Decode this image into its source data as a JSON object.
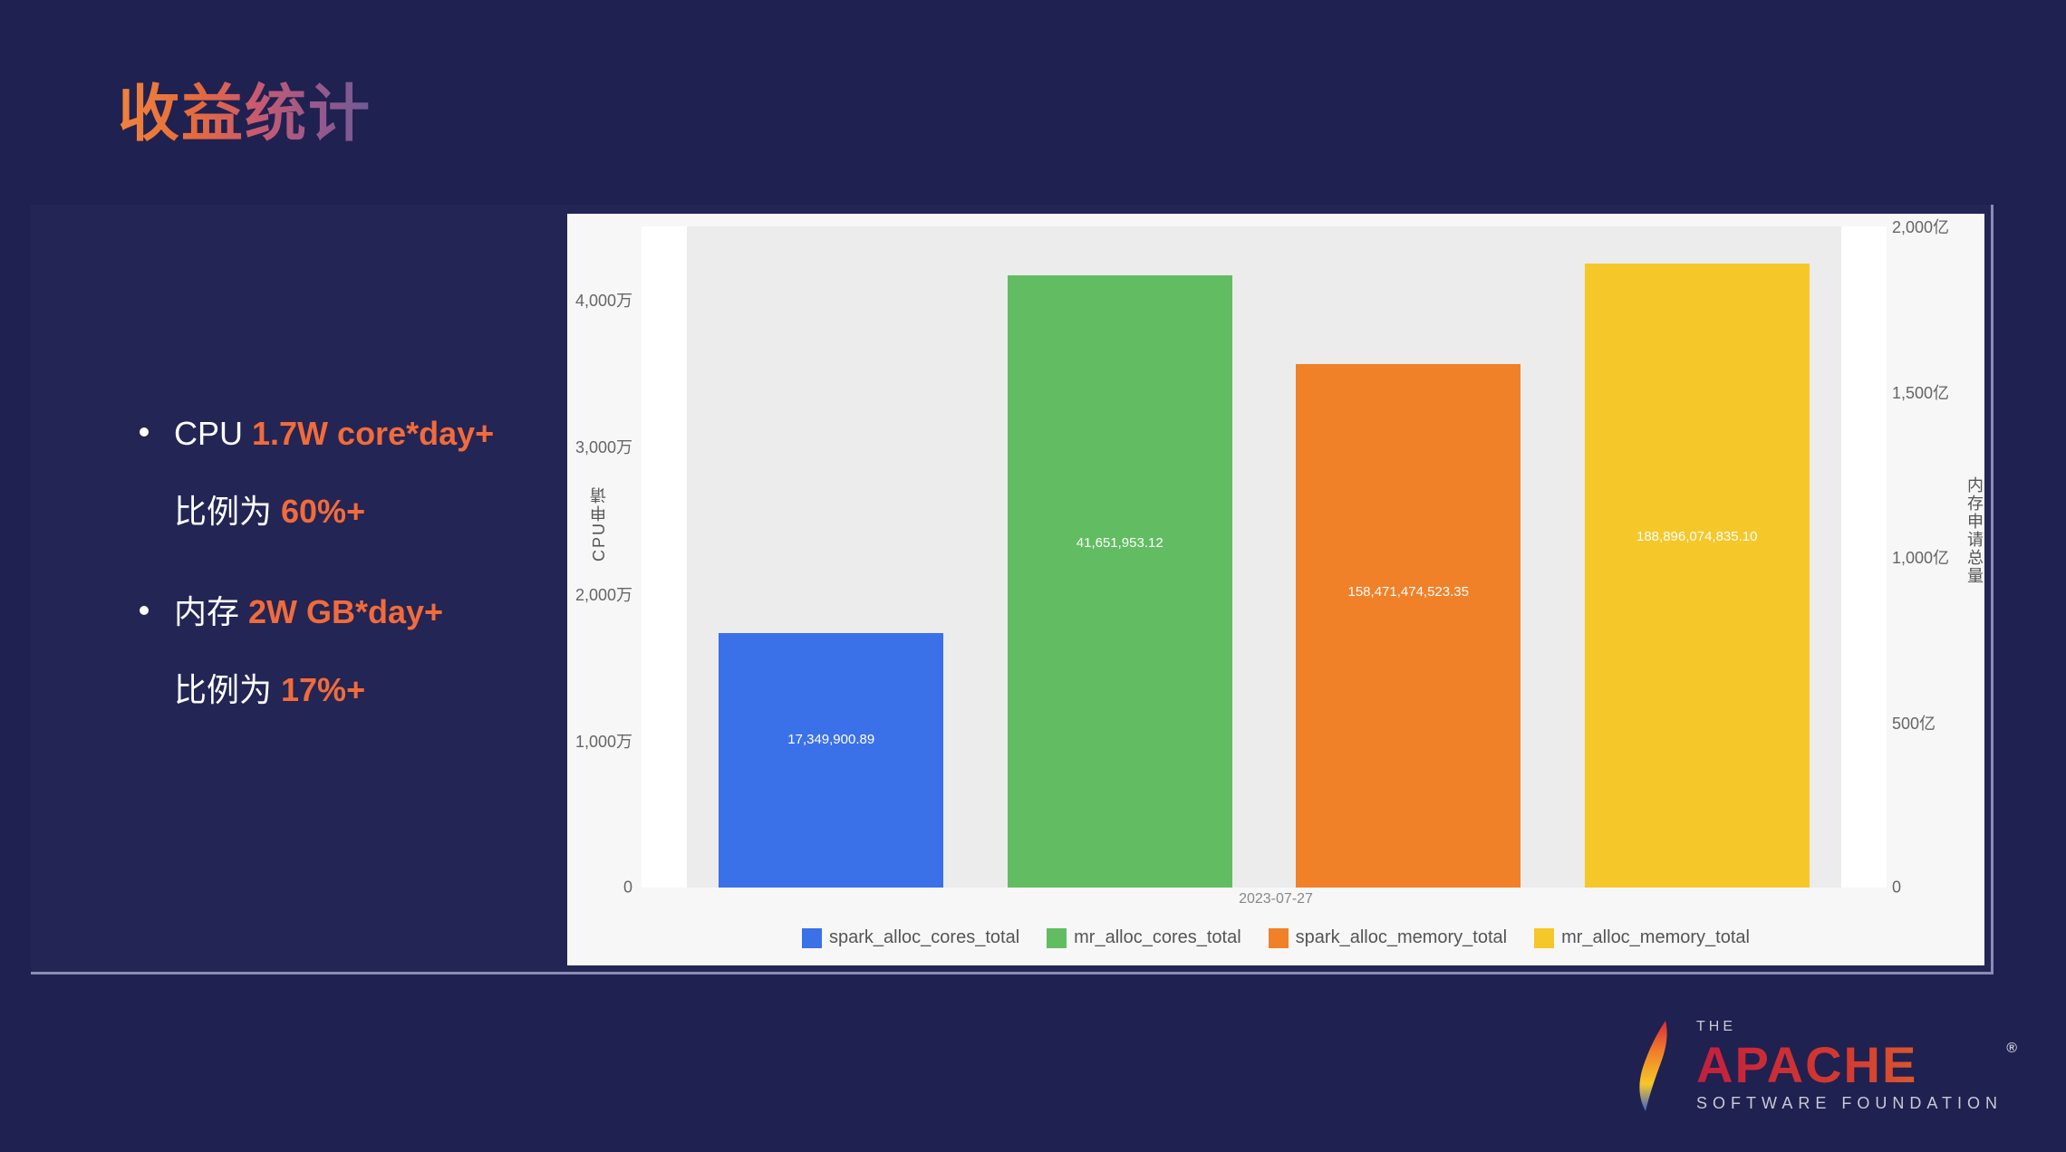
{
  "title": "收益统计",
  "bullets": [
    {
      "pre": "CPU ",
      "hl1": "1.7W core*day+",
      "line2pre": "比例为 ",
      "hl2": "60%+"
    },
    {
      "pre": "内存 ",
      "hl1": "2W GB*day+",
      "line2pre": "比例为 ",
      "hl2": "17%+"
    }
  ],
  "footer": {
    "the": "THE",
    "name": "APACHE",
    "sub": "SOFTWARE FOUNDATION",
    "reg": "®"
  },
  "chart_data": {
    "type": "bar",
    "x_date": "2023-07-27",
    "y_left": {
      "label": "CPU申请",
      "ticks": [
        "0",
        "1,000万",
        "2,000万",
        "3,000万",
        "4,000万"
      ],
      "max": 45000000
    },
    "y_right": {
      "label": "内存申请总量",
      "ticks": [
        "0",
        "500亿",
        "1,000亿",
        "1,500亿",
        "2,000亿"
      ],
      "max": 200000000000
    },
    "series": [
      {
        "name": "spark_alloc_cores_total",
        "color": "#3b71e8",
        "axis": "left",
        "value": 17349900.89,
        "label": "17,349,900.89"
      },
      {
        "name": "mr_alloc_cores_total",
        "color": "#62bd62",
        "axis": "left",
        "value": 41651953.12,
        "label": "41,651,953.12"
      },
      {
        "name": "spark_alloc_memory_total",
        "color": "#f08128",
        "axis": "right",
        "value": 158471474523.35,
        "label": "158,471,474,523.35"
      },
      {
        "name": "mr_alloc_memory_total",
        "color": "#f6c729",
        "axis": "right",
        "value": 188896074835.1,
        "label": "188,896,074,835.10"
      }
    ]
  }
}
